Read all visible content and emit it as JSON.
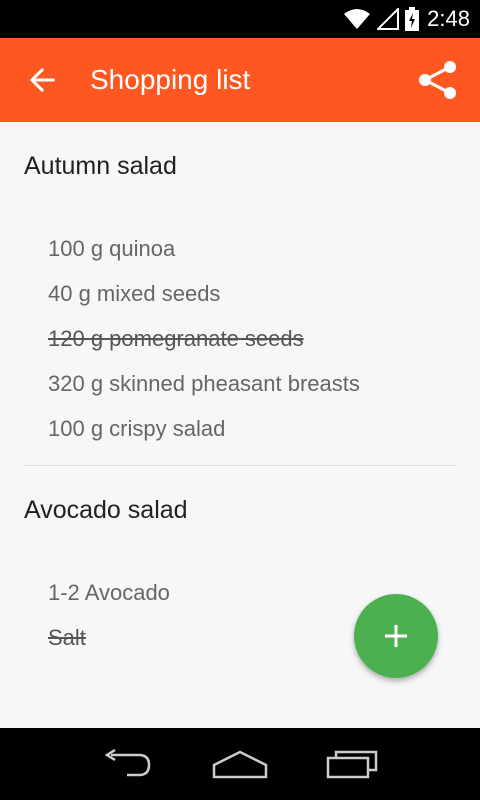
{
  "status_bar": {
    "time": "2:48"
  },
  "app_bar": {
    "title": "Shopping list"
  },
  "sections": [
    {
      "title": "Autumn salad",
      "items": [
        {
          "text": "100 g quinoa",
          "checked": false
        },
        {
          "text": "40 g mixed seeds",
          "checked": false
        },
        {
          "text": "120 g pomegranate seeds",
          "checked": true
        },
        {
          "text": "320 g skinned pheasant breasts",
          "checked": false
        },
        {
          "text": "100 g crispy salad",
          "checked": false
        }
      ]
    },
    {
      "title": "Avocado salad",
      "items": [
        {
          "text": "1-2 Avocado",
          "checked": false
        },
        {
          "text": "Salt",
          "checked": true
        }
      ]
    }
  ],
  "colors": {
    "app_bar": "#FF5722",
    "fab": "#4CAF50",
    "background": "#F7F7F7"
  },
  "icons": {
    "back": "arrow-back-icon",
    "share": "share-icon",
    "fab": "add-icon"
  }
}
